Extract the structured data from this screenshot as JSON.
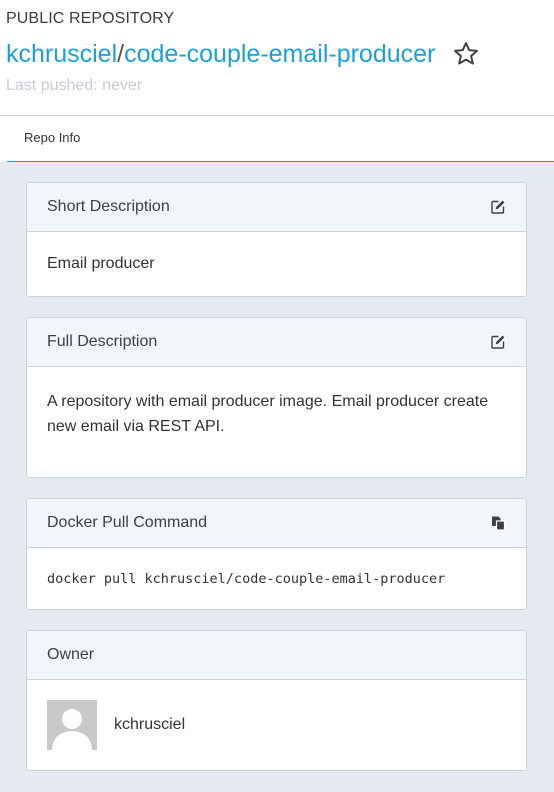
{
  "header": {
    "repo_kind": "PUBLIC REPOSITORY",
    "namespace": "kchrusciel",
    "separator": "/",
    "repo_name": "code-couple-email-producer",
    "last_pushed": "Last pushed: never",
    "star_icon": "star-outline-icon"
  },
  "tabs": [
    {
      "label": "Repo Info",
      "active": true
    }
  ],
  "cards": {
    "short_description": {
      "title": "Short Description",
      "body": "Email producer",
      "icon": "edit-icon"
    },
    "full_description": {
      "title": "Full Description",
      "body": "A repository with email producer image. Email producer create new email via REST API.",
      "icon": "edit-icon"
    },
    "docker_pull": {
      "title": "Docker Pull Command",
      "command": "docker pull kchrusciel/code-couple-email-producer",
      "icon": "copy-icon"
    },
    "owner": {
      "title": "Owner",
      "name": "kchrusciel",
      "avatar": "default-avatar"
    }
  },
  "colors": {
    "accent": "#1e9fd6",
    "background": "#e6ebf1",
    "card_header": "#f2f5f9",
    "muted_text": "#c6cdd3"
  }
}
